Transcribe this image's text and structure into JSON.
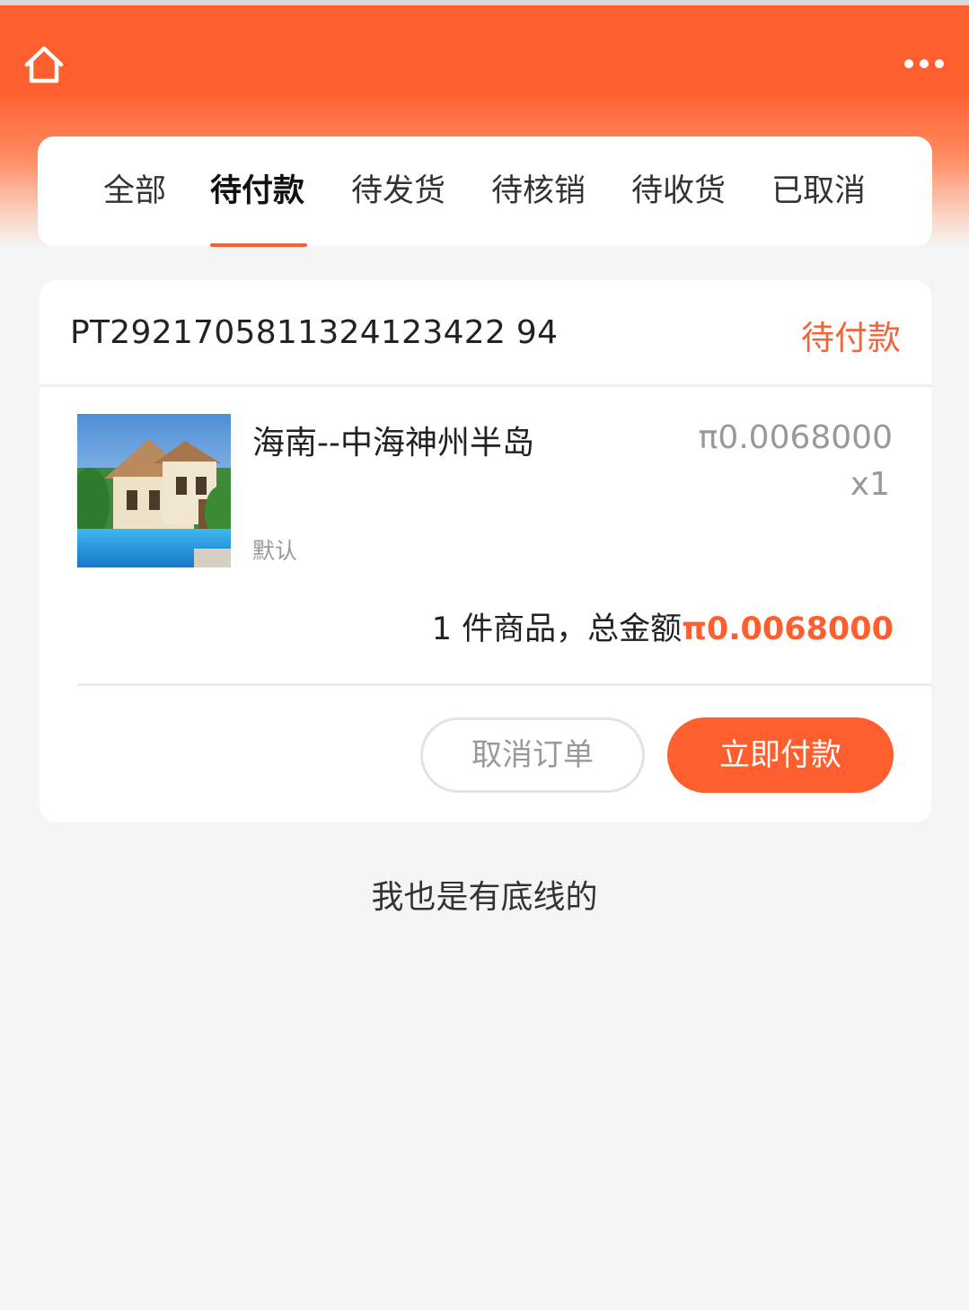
{
  "header": {
    "home_icon": "home-icon",
    "more_icon": "more-dots-icon",
    "accent_color": "#ff5e2f"
  },
  "tabs": [
    {
      "label": "全部",
      "active": false
    },
    {
      "label": "待付款",
      "active": true
    },
    {
      "label": "待发货",
      "active": false
    },
    {
      "label": "待核销",
      "active": false
    },
    {
      "label": "待收货",
      "active": false
    },
    {
      "label": "已取消",
      "active": false
    }
  ],
  "order": {
    "order_no": "PT2921705811324123422 94",
    "status": "待付款",
    "product": {
      "name": "海南--中海神州半岛",
      "spec": "默认",
      "price": "π0.0068000",
      "qty": "x1"
    },
    "summary_prefix": "1 件商品，总金额",
    "summary_amount": "π0.0068000",
    "cancel_label": "取消订单",
    "pay_label": "立即付款"
  },
  "footer": {
    "note": "我也是有底线的"
  }
}
